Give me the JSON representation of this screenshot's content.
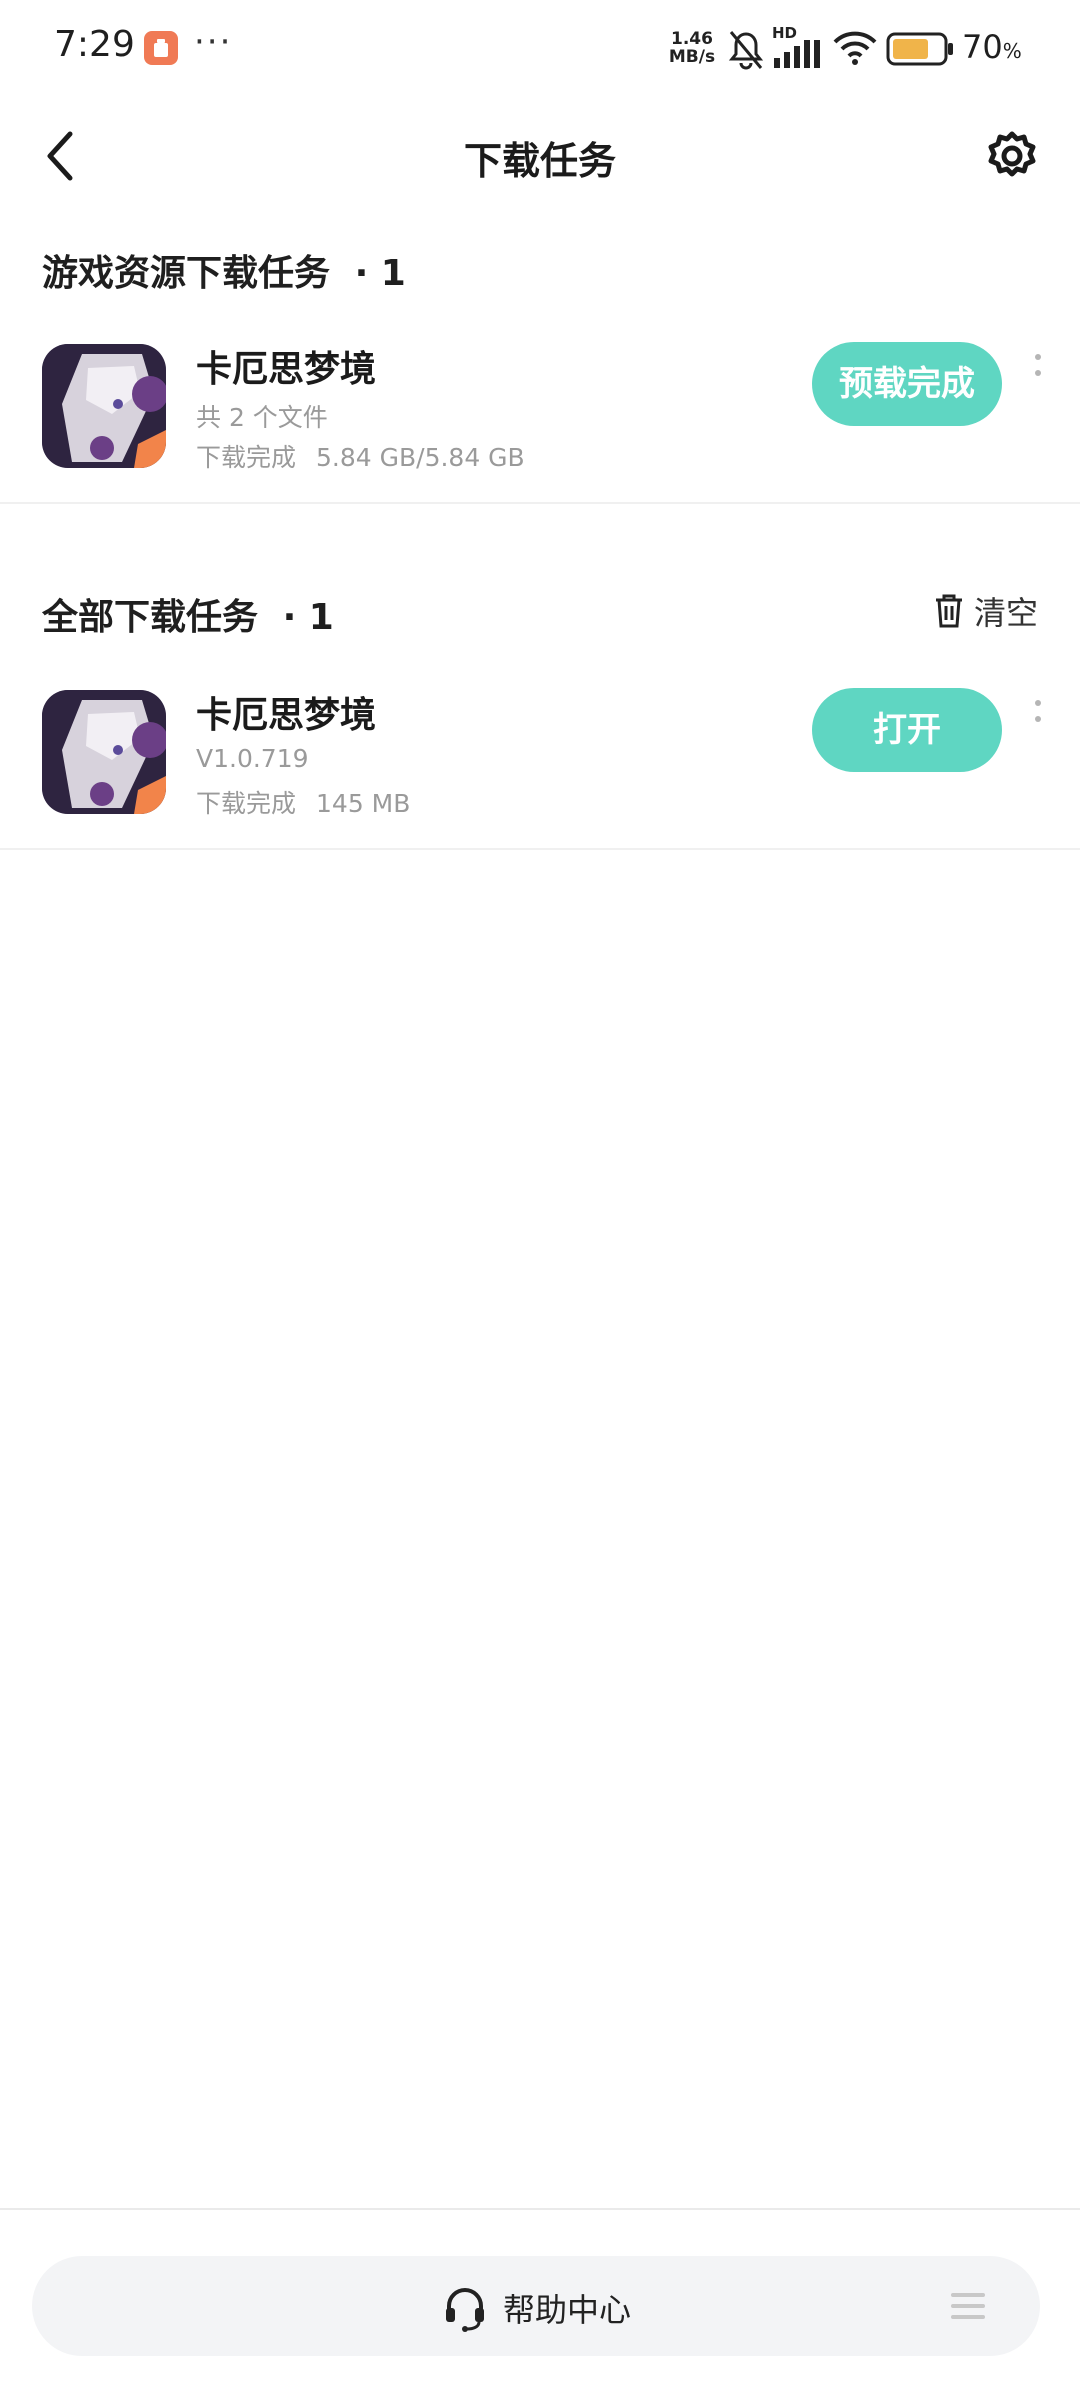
{
  "status_bar": {
    "time": "7:29",
    "dots": "···",
    "net_speed_value": "1.46",
    "net_speed_unit": "MB/s",
    "battery_percent": "70",
    "battery_percent_sign": "%",
    "signal_label": "HD"
  },
  "nav": {
    "title": "下载任务"
  },
  "game_resources": {
    "title": "游戏资源下载任务",
    "count": "· 1",
    "items": [
      {
        "name": "卡厄思梦境",
        "subtitle": "共 2 个文件",
        "status": "下载完成",
        "size": "5.84 GB/5.84 GB",
        "button": "预载完成"
      }
    ]
  },
  "all_downloads": {
    "title": "全部下载任务",
    "count": "· 1",
    "clear_label": "清空",
    "items": [
      {
        "name": "卡厄思梦境",
        "subtitle": "V1.0.719",
        "status": "下载完成",
        "size": "145 MB",
        "button": "打开"
      }
    ]
  },
  "bottom": {
    "help_label": "帮助中心"
  },
  "colors": {
    "accent": "#5fd6c2",
    "notification_badge": "#f07a55",
    "battery_fill": "#f0b44a"
  },
  "icons": {
    "back": "chevron-left-icon",
    "settings": "gear-icon",
    "clear": "trash-icon",
    "help": "headset-icon",
    "menu": "menu-icon"
  }
}
